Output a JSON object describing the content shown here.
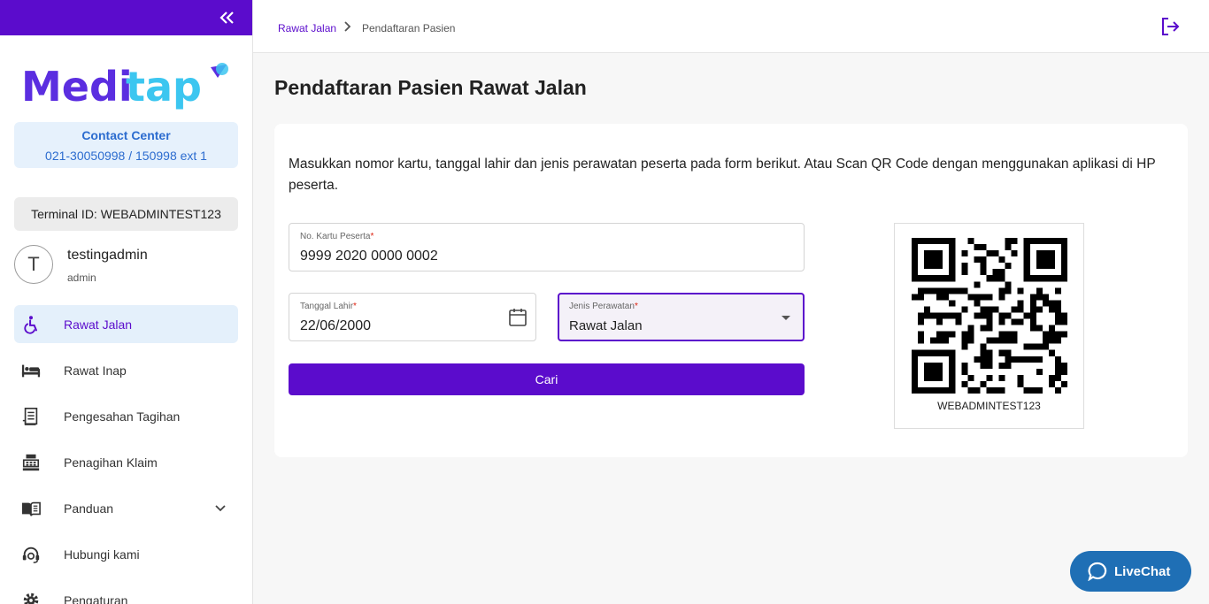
{
  "sidebar": {
    "brand": {
      "part1": "Medi",
      "part2": "tap",
      "color1": "#5b2ee0",
      "color2": "#3cc6f0"
    },
    "contact": {
      "title": "Contact Center",
      "phone": "021-30050998 / 150998 ext 1"
    },
    "terminal": "Terminal ID: WEBADMINTEST123",
    "user": {
      "initial": "T",
      "name": "testingadmin",
      "role": "admin"
    },
    "items": [
      {
        "label": "Rawat Jalan",
        "icon": "wheelchair-icon",
        "active": true
      },
      {
        "label": "Rawat Inap",
        "icon": "bed-icon"
      },
      {
        "label": "Pengesahan Tagihan",
        "icon": "receipt-icon"
      },
      {
        "label": "Penagihan Klaim",
        "icon": "cash-register-icon"
      },
      {
        "label": "Panduan",
        "icon": "book-icon",
        "has_submenu": true
      },
      {
        "label": "Hubungi kami",
        "icon": "headset-icon"
      },
      {
        "label": "Pengaturan",
        "icon": "gear-icon"
      }
    ]
  },
  "breadcrumb": {
    "parent": "Rawat Jalan",
    "current": "Pendaftaran Pasien"
  },
  "page": {
    "title": "Pendaftaran Pasien Rawat Jalan",
    "intro": "Masukkan nomor kartu, tanggal lahir dan jenis perawatan peserta pada form berikut. Atau Scan QR Code dengan menggunakan aplikasi di HP peserta."
  },
  "form": {
    "kartu": {
      "label": "No. Kartu Peserta",
      "required": "*",
      "value": "9999 2020 0000 0002"
    },
    "tanggal": {
      "label": "Tanggal Lahir",
      "required": "*",
      "value": "22/06/2000"
    },
    "jenis": {
      "label": "Jenis Perawatan",
      "required": "*",
      "value": "Rawat Jalan"
    },
    "submit_label": "Cari"
  },
  "qr": {
    "caption": "WEBADMINTEST123"
  },
  "livechat": {
    "label": "LiveChat"
  },
  "colors": {
    "primary": "#5b0ccc",
    "livechat": "#1f6fb5"
  }
}
